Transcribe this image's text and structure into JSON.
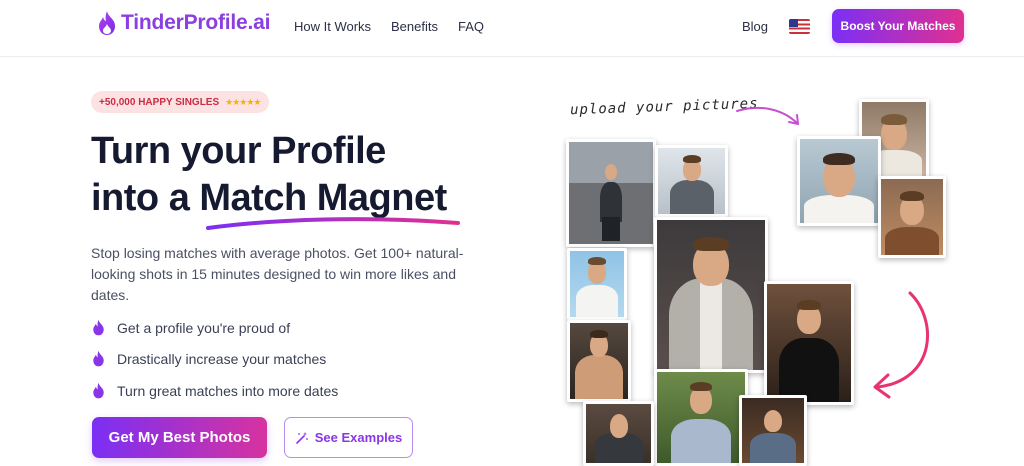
{
  "header": {
    "logo_text": "TinderProfile.ai",
    "nav": [
      "How It Works",
      "Benefits",
      "FAQ"
    ],
    "blog": "Blog",
    "language_flag": "us-flag-icon",
    "boost_button": "Boost Your Matches"
  },
  "hero": {
    "badge_text": "+50,000 HAPPY SINGLES",
    "badge_stars": "★★★★★",
    "title_line1": "Turn your Profile",
    "title_line2_prefix": "into a",
    "title_line2_highlight": "Match Magnet",
    "description": "Stop losing matches with average photos. Get 100+ natural-looking shots in 15 minutes designed to win more likes and dates.",
    "features": [
      "Get a profile you're proud of",
      "Drastically increase your matches",
      "Turn great matches into more dates"
    ],
    "primary_cta": "Get My Best Photos",
    "secondary_cta": "See Examples"
  },
  "collage": {
    "upload_label": "upload your pictures"
  },
  "colors": {
    "brand_purple": "#8b3fe0",
    "brand_pink": "#e0308f",
    "badge_bg": "#fde2e4",
    "badge_text": "#c92c43",
    "arrow_pink": "#e8336f"
  }
}
